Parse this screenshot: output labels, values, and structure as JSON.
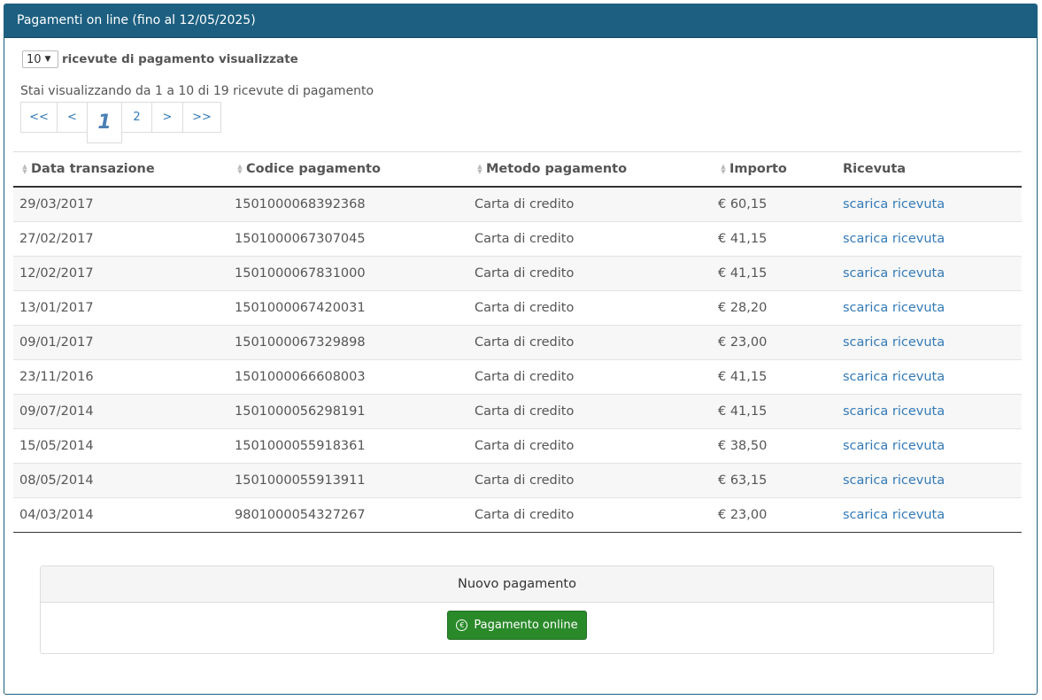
{
  "panel": {
    "title": "Pagamenti on line (fino al 12/05/2025)"
  },
  "perpage": {
    "value": "10",
    "caret": "▼",
    "label": "ricevute di pagamento visualizzate"
  },
  "status": "Stai visualizzando da 1 a 10 di 19 ricevute di pagamento",
  "pager": {
    "first": "<<",
    "prev": "<",
    "page1": "1",
    "page2": "2",
    "next": ">",
    "last": ">>"
  },
  "table": {
    "headers": [
      "Data transazione",
      "Codice pagamento",
      "Metodo pagamento",
      "Importo",
      "Ricevuta"
    ],
    "rows": [
      [
        "29/03/2017",
        "1501000068392368",
        "Carta di credito",
        "€ 60,15",
        "scarica ricevuta"
      ],
      [
        "27/02/2017",
        "1501000067307045",
        "Carta di credito",
        "€ 41,15",
        "scarica ricevuta"
      ],
      [
        "12/02/2017",
        "1501000067831000",
        "Carta di credito",
        "€ 41,15",
        "scarica ricevuta"
      ],
      [
        "13/01/2017",
        "1501000067420031",
        "Carta di credito",
        "€ 28,20",
        "scarica ricevuta"
      ],
      [
        "09/01/2017",
        "1501000067329898",
        "Carta di credito",
        "€ 23,00",
        "scarica ricevuta"
      ],
      [
        "23/11/2016",
        "1501000066608003",
        "Carta di credito",
        "€ 41,15",
        "scarica ricevuta"
      ],
      [
        "09/07/2014",
        "1501000056298191",
        "Carta di credito",
        "€ 41,15",
        "scarica ricevuta"
      ],
      [
        "15/05/2014",
        "1501000055918361",
        "Carta di credito",
        "€ 38,50",
        "scarica ricevuta"
      ],
      [
        "08/05/2014",
        "1501000055913911",
        "Carta di credito",
        "€ 63,15",
        "scarica ricevuta"
      ],
      [
        "04/03/2014",
        "9801000054327267",
        "Carta di credito",
        "€ 23,00",
        "scarica ricevuta"
      ]
    ]
  },
  "newpayment": {
    "title": "Nuovo pagamento",
    "button": "Pagamento online",
    "icon": "euro-circle-icon",
    "euro": "€"
  },
  "colors": {
    "header": "#1c5f80",
    "button": "#2a8a2a",
    "link": "#337ab7"
  }
}
